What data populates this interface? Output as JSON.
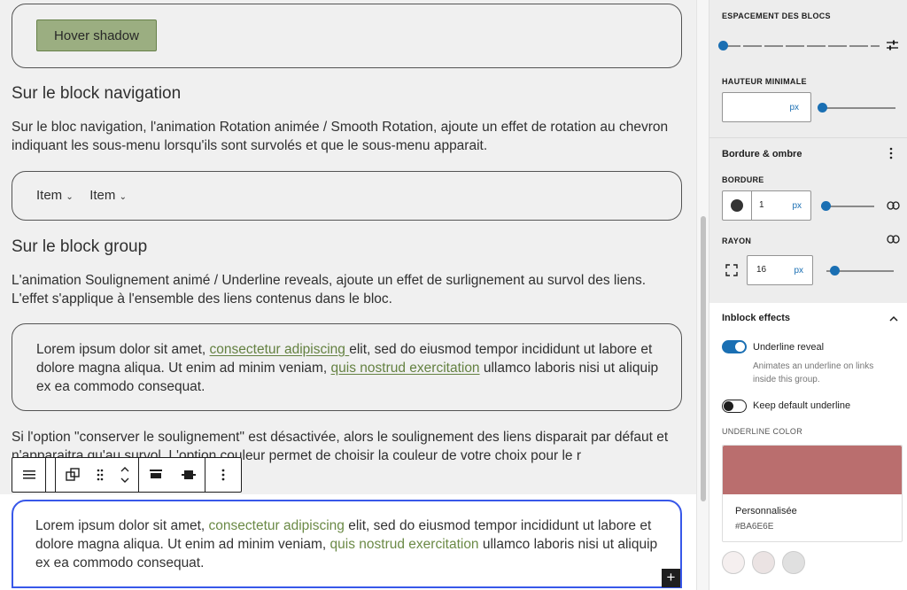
{
  "editor": {
    "hover_button": "Hover shadow",
    "heading_nav": "Sur le block navigation",
    "para_nav": "Sur le bloc navigation, l'animation Rotation animée / Smooth Rotation, ajoute un effet de rotation au chevron indiquant les sous-menu lorsqu'ils sont survolés et que le sous-menu apparait.",
    "nav_items": [
      "Item",
      "Item"
    ],
    "heading_group": "Sur le block group",
    "para_group": "L'animation Soulignement animé / Underline reveals, ajoute un effet de surlignement au survol des liens. L'effet s'applique à l'ensemble des liens contenus dans le bloc.",
    "lorem": {
      "part1": "Lorem ipsum dolor sit amet, ",
      "link1": "consectetur adipiscing ",
      "part2": "elit, sed do eiusmod tempor incididunt ut labore et dolore magna aliqua. Ut enim ad minim veniam, ",
      "link2": "quis nostrud exercitation",
      "part3": " ullamco laboris nisi ut aliquip ex ea commodo consequat."
    },
    "para_option": "Si l'option \"conserver le soulignement\" est désactivée, alors le soulignement des liens disparait par défaut et n'apparaitra qu'au survol. L'option couleur permet de choisir la couleur de votre choix pour le r"
  },
  "sidebar": {
    "block_spacing_label": "ESPACEMENT DES BLOCS",
    "min_height_label": "HAUTEUR MINIMALE",
    "min_height_unit": "px",
    "border_shadow_title": "Bordure & ombre",
    "border_label": "BORDURE",
    "border_value": "1",
    "border_unit": "px",
    "radius_label": "RAYON",
    "radius_value": "16",
    "radius_unit": "px",
    "inblock_title": "Inblock effects",
    "underline_reveal_label": "Underline reveal",
    "underline_reveal_help": "Animates an underline on links inside this group.",
    "keep_default_label": "Keep default underline",
    "underline_color_label": "UNDERLINE COLOR",
    "color_name": "Personnalisée",
    "color_hex": "#BA6E6E",
    "color_value": "#ba6e6e",
    "underline_reveal_on": true,
    "keep_default_on": false
  }
}
